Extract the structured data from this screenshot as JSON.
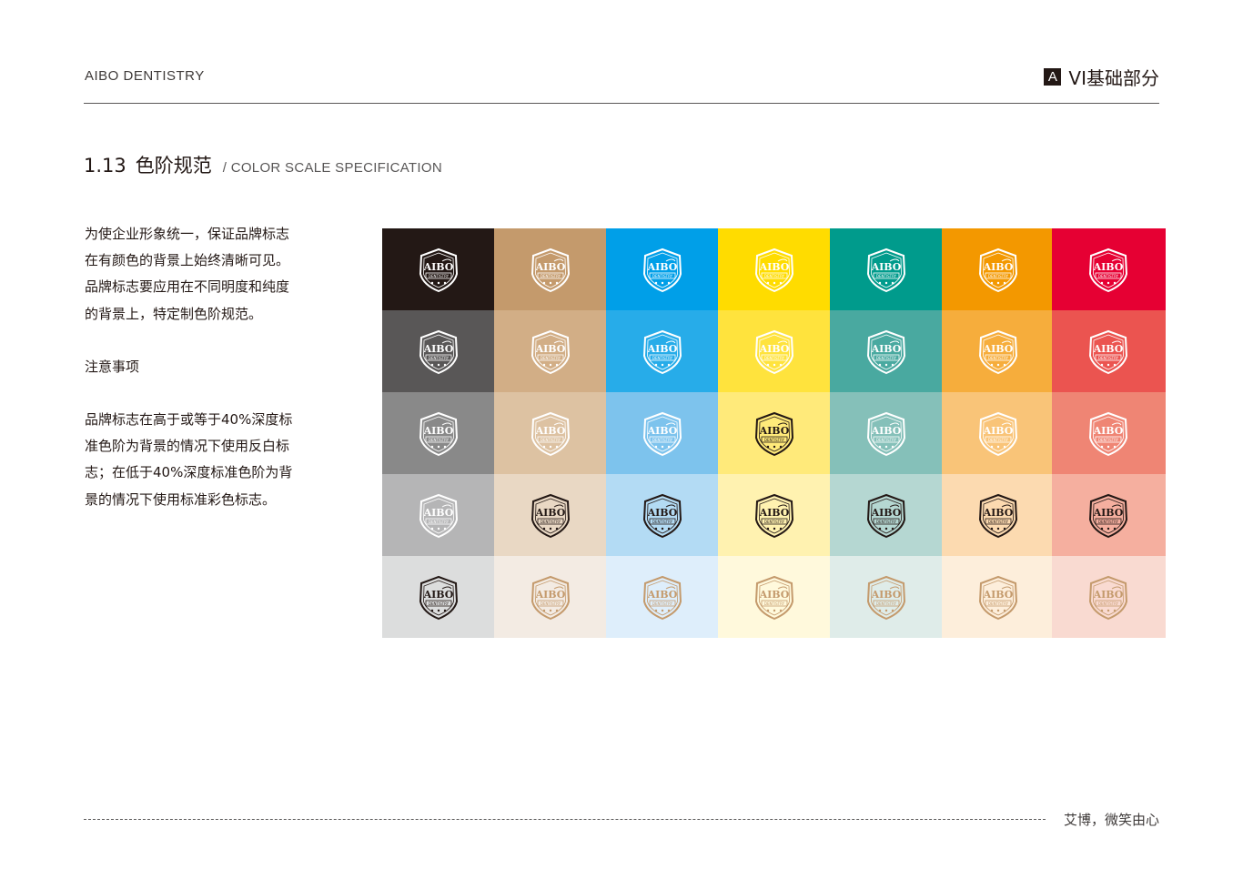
{
  "header": {
    "brand": "AIBO DENTISTRY",
    "section_badge": "A",
    "section_label": "VI基础部分"
  },
  "title": {
    "number": "1.13",
    "cn": "色阶规范",
    "en": "/ COLOR SCALE SPECIFICATION"
  },
  "body": {
    "para1": [
      "为使企业形象统一，保证品牌标志",
      "在有颜色的背景上始终清晰可见。",
      "品牌标志要应用在不同明度和纯度",
      "的背景上，特定制色阶规范。"
    ],
    "note_title": "注意事项",
    "para2": [
      "品牌标志在高于或等于40%深度标",
      "准色阶为背景的情况下使用反白标",
      "志；在低于40%深度标准色阶为背",
      "景的情况下使用标准彩色标志。"
    ]
  },
  "logo": {
    "main": "AIBO",
    "sub": "DENTISTRY"
  },
  "color_scale": {
    "columns": [
      {
        "name": "black",
        "colors": [
          "#231815",
          "#595757",
          "#898989",
          "#b5b5b6",
          "#dcdddd"
        ],
        "logo_variants": [
          "white",
          "white",
          "white",
          "white",
          "black"
        ]
      },
      {
        "name": "gold",
        "colors": [
          "#c49a6c",
          "#d2ae86",
          "#ddc2a2",
          "#e9d8c4",
          "#f3ebe3"
        ],
        "logo_variants": [
          "white",
          "white",
          "white",
          "black",
          "gold"
        ]
      },
      {
        "name": "blue",
        "colors": [
          "#009fe8",
          "#27ace9",
          "#7dc3ed",
          "#b3dbf4",
          "#deeefb"
        ],
        "logo_variants": [
          "white",
          "white",
          "white",
          "black",
          "gold"
        ]
      },
      {
        "name": "yellow",
        "colors": [
          "#ffdc00",
          "#ffe33d",
          "#ffea7a",
          "#fff2b0",
          "#fff9dc"
        ],
        "logo_variants": [
          "white",
          "white",
          "black",
          "black",
          "gold"
        ]
      },
      {
        "name": "teal",
        "colors": [
          "#009b8c",
          "#49a9a0",
          "#85c0b9",
          "#b5d7d2",
          "#dfece9"
        ],
        "logo_variants": [
          "white",
          "white",
          "white",
          "black",
          "gold"
        ]
      },
      {
        "name": "orange",
        "colors": [
          "#f39800",
          "#f6ad3c",
          "#f9c478",
          "#fcdab0",
          "#fdeedb"
        ],
        "logo_variants": [
          "white",
          "white",
          "white",
          "black",
          "gold"
        ]
      },
      {
        "name": "red",
        "colors": [
          "#e60033",
          "#eb5450",
          "#ef8574",
          "#f5af9f",
          "#f9dad1"
        ],
        "logo_variants": [
          "white",
          "white",
          "white",
          "black",
          "gold"
        ]
      }
    ],
    "variant_colors": {
      "white": "#ffffff",
      "black": "#231815",
      "gold": "#c49a6c"
    }
  },
  "footer": {
    "slogan": "艾博，微笑由心"
  }
}
